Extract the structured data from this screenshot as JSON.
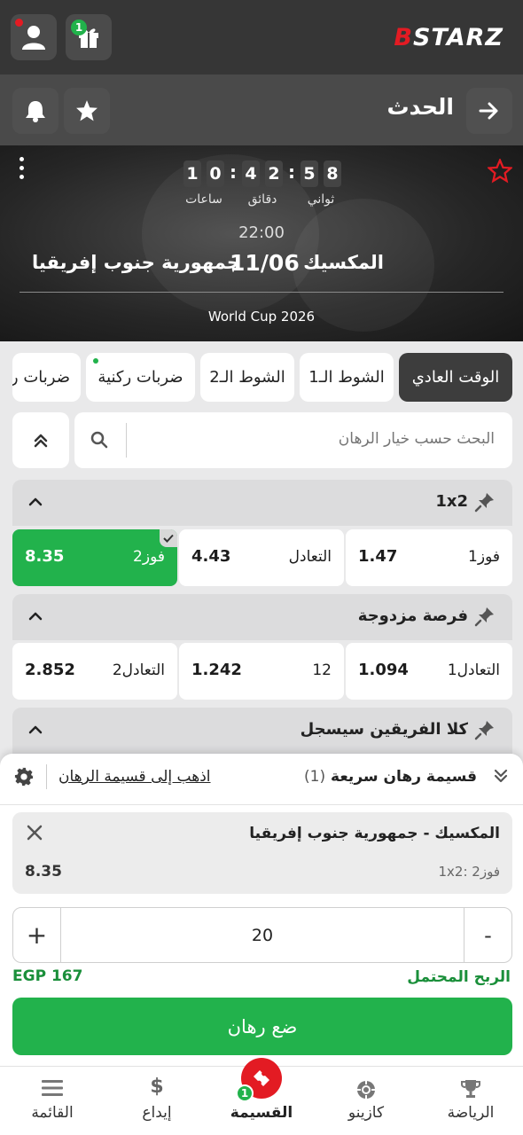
{
  "brand": {
    "logo_prefix": "B",
    "logo_text": "STARZ",
    "color_accent": "#e31b23",
    "color_green": "#22b24c"
  },
  "topbar": {
    "gift_badge": "1"
  },
  "header": {
    "title": "الحدث"
  },
  "event": {
    "countdown": {
      "hours": [
        "1",
        "0"
      ],
      "minutes": [
        "4",
        "2"
      ],
      "seconds": [
        "5",
        "8"
      ],
      "hours_label": "ساعات",
      "minutes_label": "دقائق",
      "seconds_label": "ثواني"
    },
    "time": "22:00",
    "date": "11/06",
    "home_team": "المكسيك",
    "away_team": "جمهورية جنوب إفريقيا",
    "tournament": "World Cup 2026"
  },
  "tabs": [
    {
      "label": "الوقت العادي",
      "active": true
    },
    {
      "label": "الشوط الـ1"
    },
    {
      "label": "الشوط الـ2"
    },
    {
      "label": "ضربات ركنية",
      "dot": true
    },
    {
      "label": "ضربات ر"
    }
  ],
  "search": {
    "placeholder": "البحث حسب خيار الرهان"
  },
  "markets": [
    {
      "title": "1x2",
      "outcomes": [
        {
          "label": "فوز1",
          "odd": "1.47"
        },
        {
          "label": "التعادل",
          "odd": "4.43"
        },
        {
          "label": "فوز2",
          "odd": "8.35",
          "selected": true
        }
      ]
    },
    {
      "title": "فرصة مزدوجة",
      "outcomes": [
        {
          "label": "1التعادل",
          "odd": "1.094"
        },
        {
          "label": "12",
          "odd": "1.242"
        },
        {
          "label": "2التعادل",
          "odd": "2.852"
        }
      ]
    },
    {
      "title": "كلا الفريقين سيسجل"
    }
  ],
  "betslip": {
    "title": "قسيمة رهان سريعة",
    "count": "(1)",
    "goto_link": "اذهب إلى قسيمة الرهان",
    "bet": {
      "match": "المكسيك - جمهورية جنوب إفريقيا",
      "market": "1x2: فوز2",
      "odd": "8.35"
    },
    "stake": "20",
    "potential_win_label": "الربح المحتمل",
    "potential_win_value": "EGP 167",
    "place_bet_label": "ضع رهان"
  },
  "bottomnav": [
    {
      "label": "الرياضة",
      "icon": "trophy-icon"
    },
    {
      "label": "كازينو",
      "icon": "casino-chip-icon"
    },
    {
      "label": "القسيمة",
      "icon": "ticket-icon",
      "badge": "1"
    },
    {
      "label": "إيداع",
      "icon": "dollar-icon"
    },
    {
      "label": "القائمة",
      "icon": "menu-icon"
    }
  ]
}
